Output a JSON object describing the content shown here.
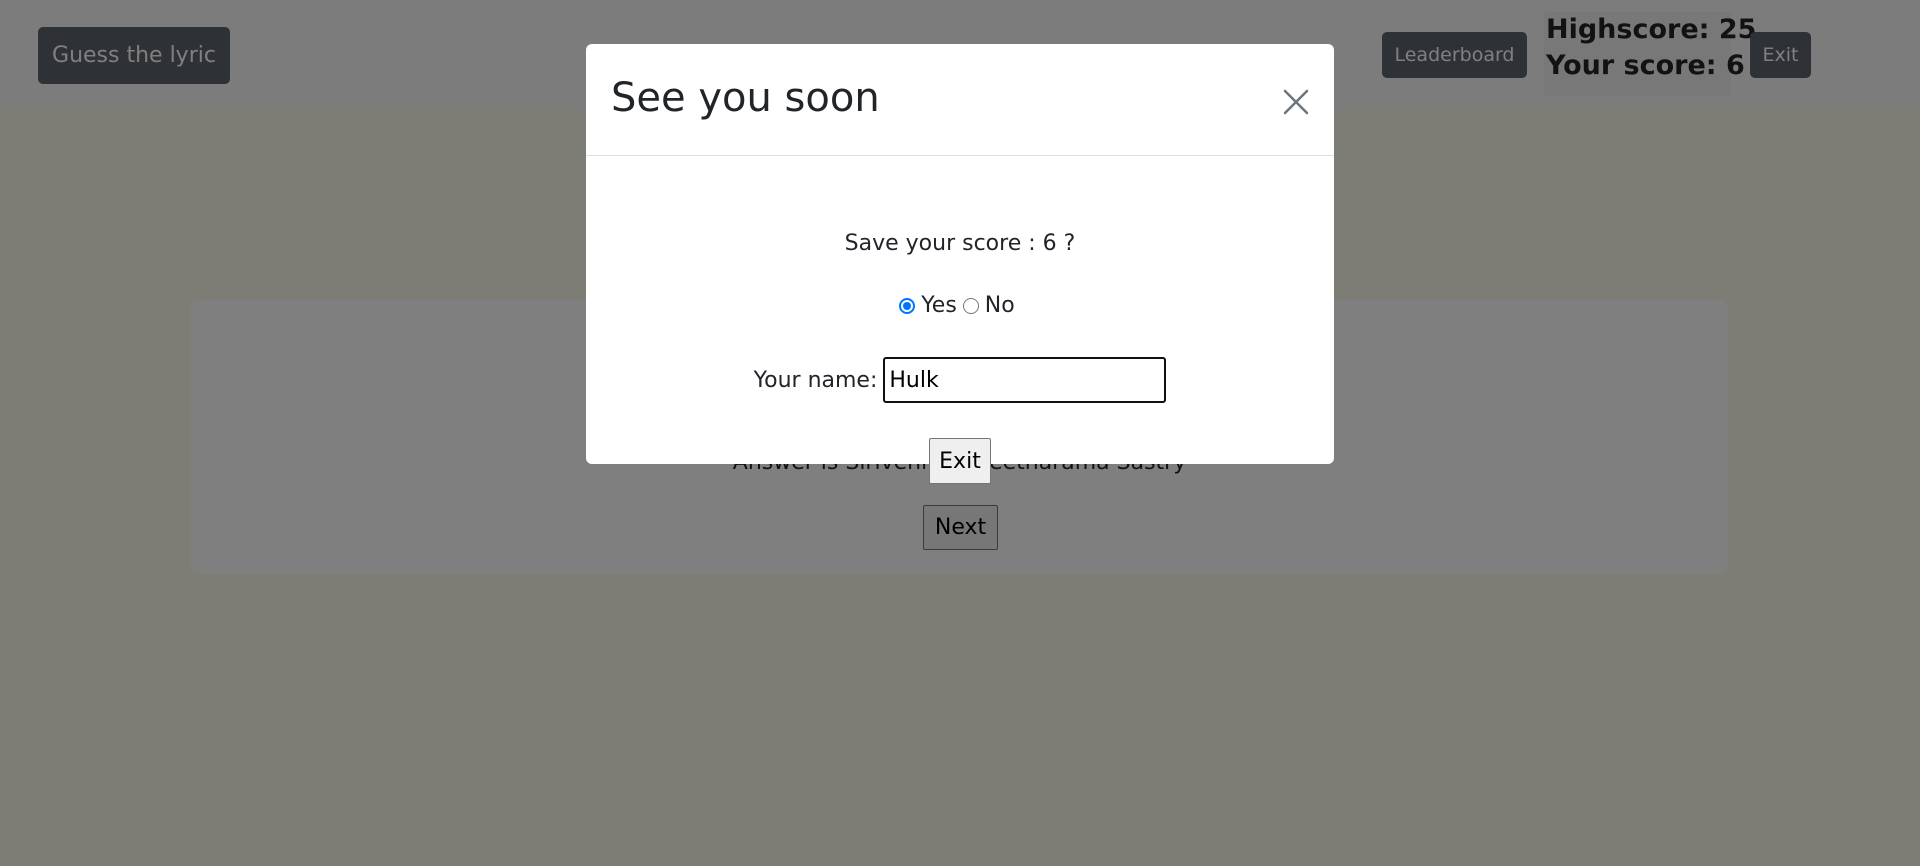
{
  "navbar": {
    "brand_label": "Guess the lyric",
    "leaderboard_label": "Leaderboard",
    "highscore_text": "Highscore: 25",
    "your_score_text": "Your score: 6",
    "exit_label": "Exit"
  },
  "card": {
    "answer_text": "Answer is Sirivennala Seetharama Sastry",
    "next_label": "Next"
  },
  "modal": {
    "title": "See you soon",
    "close_icon": "close-icon",
    "save_prompt": "Save your score : 6 ?",
    "yes_label": "Yes",
    "no_label": "No",
    "selected_option": "Yes",
    "name_label": "Your name:",
    "name_value": "Hulk",
    "exit_label": "Exit"
  },
  "colors": {
    "radio_accent": "#0075ff",
    "nav_button": "#5c636a"
  }
}
